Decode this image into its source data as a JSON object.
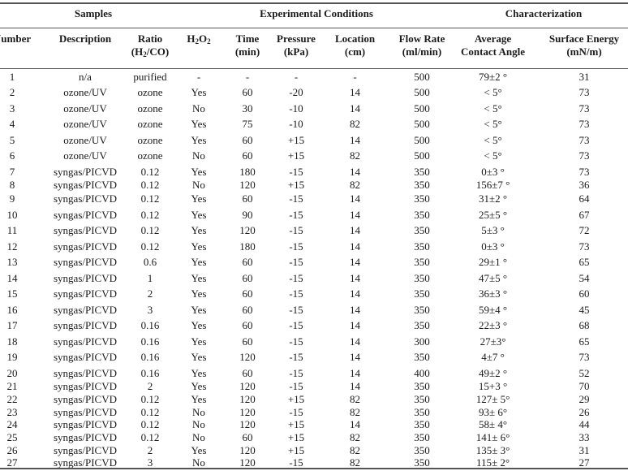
{
  "table": {
    "groups": {
      "samples": "Samples",
      "experimental": "Experimental Conditions",
      "characterization": "Characterization"
    },
    "columns": [
      {
        "line1": "Number",
        "line2": ""
      },
      {
        "line1": "Description",
        "line2": ""
      },
      {
        "line1": "Ratio",
        "line2_pre": "(H",
        "line2_sub": "2",
        "line2_post": "/CO)"
      },
      {
        "label_pre": "H",
        "sub1": "2",
        "mid": "O",
        "sub2": "2"
      },
      {
        "line1": "Time",
        "line2": "(min)"
      },
      {
        "line1": "Pressure",
        "line2": "(kPa)"
      },
      {
        "line1": "Location",
        "line2": "(cm)"
      },
      {
        "line1": "Flow Rate",
        "line2": "(ml/min)"
      },
      {
        "line1": "Average",
        "line2": "Contact Angle"
      },
      {
        "line1": "Surface Energy",
        "line2": "(mN/m)"
      }
    ],
    "rows": [
      [
        "1",
        "n/a",
        "purified",
        "-",
        "-",
        "-",
        "-",
        "500",
        "79±2 °",
        "31"
      ],
      [
        "2",
        "ozone/UV",
        "ozone",
        "Yes",
        "60",
        "-20",
        "14",
        "500",
        "< 5°",
        "73"
      ],
      [
        "3",
        "ozone/UV",
        "ozone",
        "No",
        "30",
        "-10",
        "14",
        "500",
        "< 5°",
        "73"
      ],
      [
        "4",
        "ozone/UV",
        "ozone",
        "Yes",
        "75",
        "-10",
        "82",
        "500",
        "< 5°",
        "73"
      ],
      [
        "5",
        "ozone/UV",
        "ozone",
        "Yes",
        "60",
        "+15",
        "14",
        "500",
        "< 5°",
        "73"
      ],
      [
        "6",
        "ozone/UV",
        "ozone",
        "No",
        "60",
        "+15",
        "82",
        "500",
        "< 5°",
        "73"
      ],
      [
        "7",
        "syngas/PICVD",
        "0.12",
        "Yes",
        "180",
        "-15",
        "14",
        "350",
        "0±3 °",
        "73"
      ],
      [
        "8",
        "syngas/PICVD",
        "0.12",
        "No",
        "120",
        "+15",
        "82",
        "350",
        "156±7 °",
        "36"
      ],
      [
        "9",
        "syngas/PICVD",
        "0.12",
        "Yes",
        "60",
        "-15",
        "14",
        "350",
        "31±2 °",
        "64"
      ],
      [
        "10",
        "syngas/PICVD",
        "0.12",
        "Yes",
        "90",
        "-15",
        "14",
        "350",
        "25±5 °",
        "67"
      ],
      [
        "11",
        "syngas/PICVD",
        "0.12",
        "Yes",
        "120",
        "-15",
        "14",
        "350",
        "5±3 °",
        "72"
      ],
      [
        "12",
        "syngas/PICVD",
        "0.12",
        "Yes",
        "180",
        "-15",
        "14",
        "350",
        "0±3 °",
        "73"
      ],
      [
        "13",
        "syngas/PICVD",
        "0.6",
        "Yes",
        "60",
        "-15",
        "14",
        "350",
        "29±1 °",
        "65"
      ],
      [
        "14",
        "syngas/PICVD",
        "1",
        "Yes",
        "60",
        "-15",
        "14",
        "350",
        "47±5 °",
        "54"
      ],
      [
        "15",
        "syngas/PICVD",
        "2",
        "Yes",
        "60",
        "-15",
        "14",
        "350",
        "36±3 °",
        "60"
      ],
      [
        "16",
        "syngas/PICVD",
        "3",
        "Yes",
        "60",
        "-15",
        "14",
        "350",
        "59±4 °",
        "45"
      ],
      [
        "17",
        "syngas/PICVD",
        "0.16",
        "Yes",
        "60",
        "-15",
        "14",
        "350",
        "22±3 °",
        "68"
      ],
      [
        "18",
        "syngas/PICVD",
        "0.16",
        "Yes",
        "60",
        "-15",
        "14",
        "300",
        "27±3°",
        "65"
      ],
      [
        "19",
        "syngas/PICVD",
        "0.16",
        "Yes",
        "120",
        "-15",
        "14",
        "350",
        "4±7 °",
        "73"
      ],
      [
        "20",
        "syngas/PICVD",
        "0.16",
        "Yes",
        "60",
        "-15",
        "14",
        "400",
        "49±2 °",
        "52"
      ],
      [
        "21",
        "syngas/PICVD",
        "2",
        "Yes",
        "120",
        "-15",
        "14",
        "350",
        "15+3 °",
        "70"
      ],
      [
        "22",
        "syngas/PICVD",
        "0.12",
        "Yes",
        "120",
        "+15",
        "82",
        "350",
        "127± 5°",
        "29"
      ],
      [
        "23",
        "syngas/PICVD",
        "0.12",
        "No",
        "120",
        "-15",
        "82",
        "350",
        "93± 6°",
        "26"
      ],
      [
        "24",
        "syngas/PICVD",
        "0.12",
        "No",
        "120",
        "+15",
        "14",
        "350",
        "58± 4°",
        "44"
      ],
      [
        "25",
        "syngas/PICVD",
        "0.12",
        "No",
        "60",
        "+15",
        "82",
        "350",
        "141± 6°",
        "33"
      ],
      [
        "26",
        "syngas/PICVD",
        "2",
        "Yes",
        "120",
        "+15",
        "82",
        "350",
        "135± 3°",
        "31"
      ],
      [
        "27",
        "syngas/PICVD",
        "3",
        "No",
        "120",
        "-15",
        "82",
        "350",
        "115± 2°",
        "27"
      ]
    ]
  }
}
